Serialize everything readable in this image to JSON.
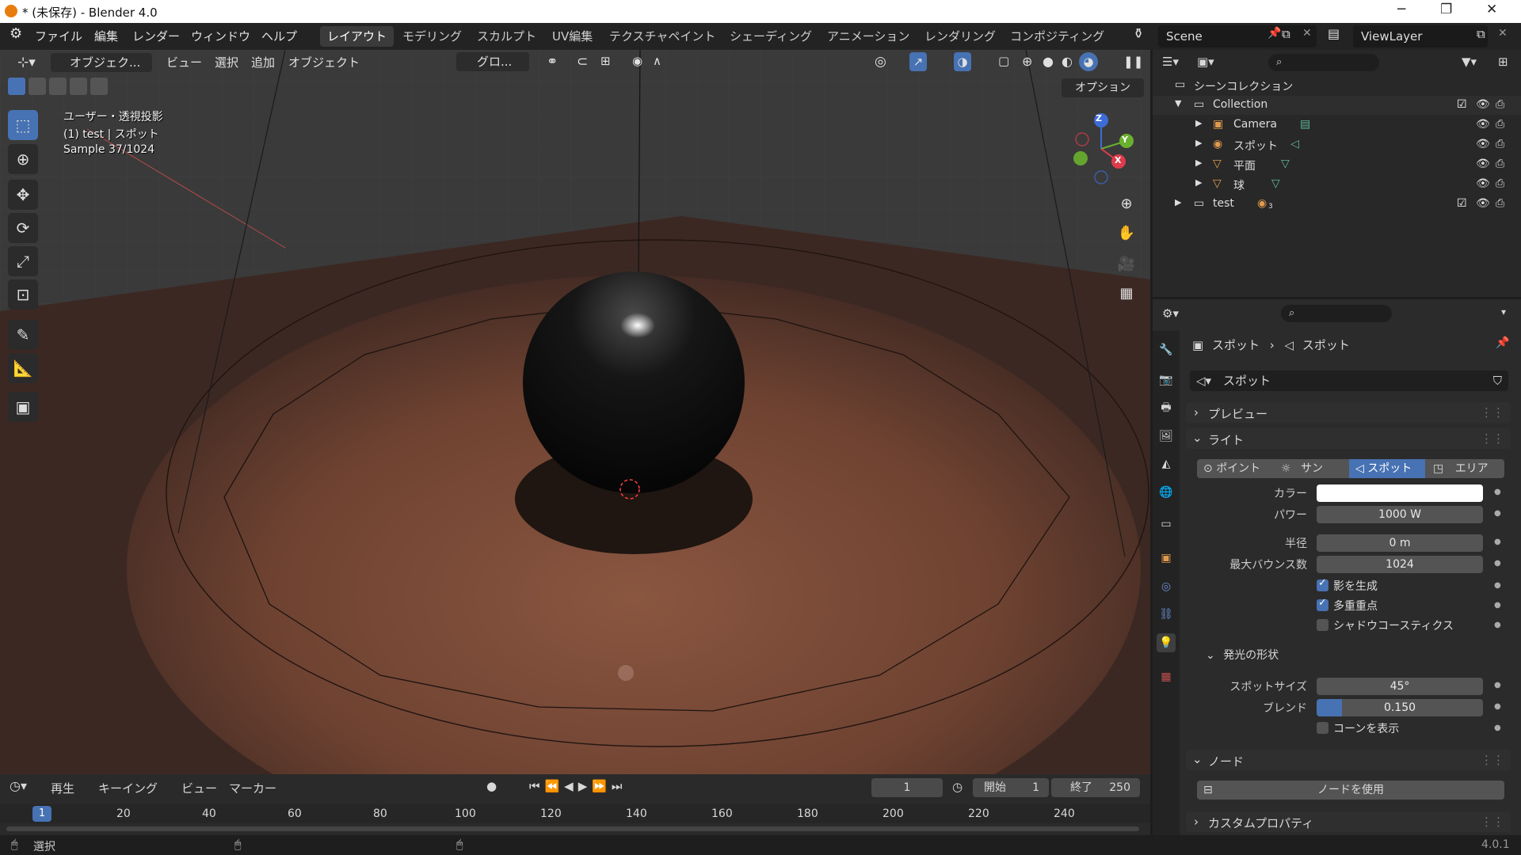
{
  "window": {
    "title": "* (未保存) - Blender 4.0",
    "min": "─",
    "max": "❐",
    "close": "✕"
  },
  "menu": {
    "file": "ファイル",
    "edit": "編集",
    "render": "レンダー",
    "window": "ウィンドウ",
    "help": "ヘルプ"
  },
  "workspaces": [
    "レイアウト",
    "モデリング",
    "スカルプト",
    "UV編集",
    "テクスチャペイント",
    "シェーディング",
    "アニメーション",
    "レンダリング",
    "コンポジティング"
  ],
  "scene": {
    "name": "Scene",
    "view_layer": "ViewLayer"
  },
  "viewport_header": {
    "mode": "オブジェク...",
    "view": "ビュー",
    "select": "選択",
    "add": "追加",
    "object": "オブジェクト",
    "transform": "グロ...",
    "options": "オプション"
  },
  "viewport_info": {
    "line1": "ユーザー・透視投影",
    "line2": "(1) test | スポット",
    "line3": "Sample 37/1024"
  },
  "gizmo": {
    "x": "X",
    "y": "Y",
    "z": "Z"
  },
  "outliner": {
    "root": "シーンコレクション",
    "collection": "Collection",
    "items": [
      {
        "label": "Camera",
        "icon": "camera-icon"
      },
      {
        "label": "スポット",
        "icon": "light-icon"
      },
      {
        "label": "平面",
        "icon": "mesh-icon"
      },
      {
        "label": "球",
        "icon": "mesh-icon"
      }
    ],
    "test": "test",
    "test_count": "3"
  },
  "properties": {
    "breadcrumb_obj": "スポット",
    "breadcrumb_data": "スポット",
    "datablock": "スポット",
    "preview": "プレビュー",
    "light": "ライト",
    "types": [
      "ポイント",
      "サン",
      "スポット",
      "エリア"
    ],
    "color_label": "カラー",
    "power_label": "パワー",
    "power": "1000 W",
    "radius_label": "半径",
    "radius": "0 m",
    "bounces_label": "最大バウンス数",
    "bounces": "1024",
    "cast_shadow": "影を生成",
    "mis": "多重重点",
    "caustics": "シャドウコースティクス",
    "beam_shape": "発光の形状",
    "spot_size_label": "スポットサイズ",
    "spot_size": "45°",
    "blend_label": "ブレンド",
    "blend": "0.150",
    "blend_fraction": 0.15,
    "show_cone": "コーンを表示",
    "nodes": "ノード",
    "use_nodes": "ノードを使用",
    "custom_props": "カスタムプロパティ"
  },
  "timeline": {
    "playback": "再生",
    "keying": "キーイング",
    "view": "ビュー",
    "marker": "マーカー",
    "current_frame": "1",
    "start_label": "開始",
    "start": "1",
    "end_label": "終了",
    "end": "250",
    "ticks": [
      "1",
      "20",
      "40",
      "60",
      "80",
      "100",
      "120",
      "140",
      "160",
      "180",
      "200",
      "220",
      "240"
    ]
  },
  "status": {
    "select": "選択",
    "version": "4.0.1"
  },
  "colors": {
    "accent": "#4772b3",
    "floor": "#7a4a35",
    "bg": "#1d1d1d"
  }
}
